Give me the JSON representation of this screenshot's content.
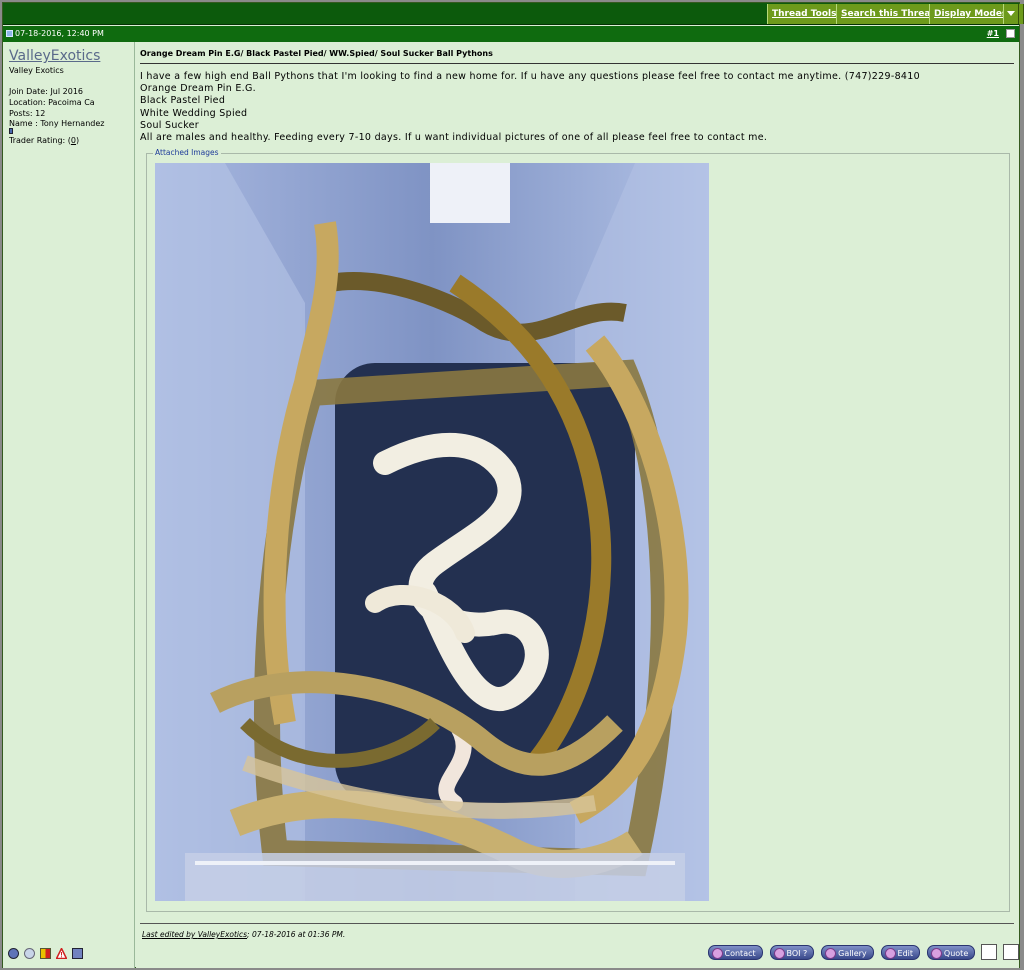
{
  "toolbar": {
    "thread_tools": "Thread Tools",
    "search_thread": "Search this Thread",
    "display_modes": "Display Modes"
  },
  "post": {
    "date": "07-18-2016, 12:40 PM",
    "number": "#1",
    "title": "Orange Dream Pin E.G/ Black Pastel Pied/ WW.Spied/ Soul Sucker Ball Pythons",
    "message": "I have a few high end Ball Pythons that I'm looking to find a new home for. If u have any questions please feel free to contact me anytime. (747)229-8410\nOrange Dream Pin E.G.\nBlack Pastel Pied\nWhite Wedding Spied\nSoul Sucker\nAll are males and healthy. Feeding every 7-10 days. If u want individual pictures of one of all please feel free to contact me.",
    "attached_label": "Attached Images",
    "edited_prefix": "Last edited by ",
    "edited_user": "ValleyExotics",
    "edited_suffix": "; 07-18-2016 at 01:36 PM."
  },
  "user": {
    "name": "ValleyExotics",
    "title": "Valley Exotics",
    "join_date": "Join Date: Jul 2016",
    "location": "Location: Pacoima Ca",
    "posts": "Posts: 12",
    "real_name": "Name : Tony Hernandez",
    "trader_rating_label": "Trader Rating: (",
    "trader_rating_value": "0",
    "trader_rating_close": ")"
  },
  "actions": {
    "contact": "Contact",
    "boi": "BOI ?",
    "gallery": "Gallery",
    "edit": "Edit",
    "quote": "Quote"
  },
  "colors": {
    "toolbar_bg": "#0c5a0c",
    "button_bg": "#6d9a1b",
    "post_bg": "#dcefd6"
  }
}
